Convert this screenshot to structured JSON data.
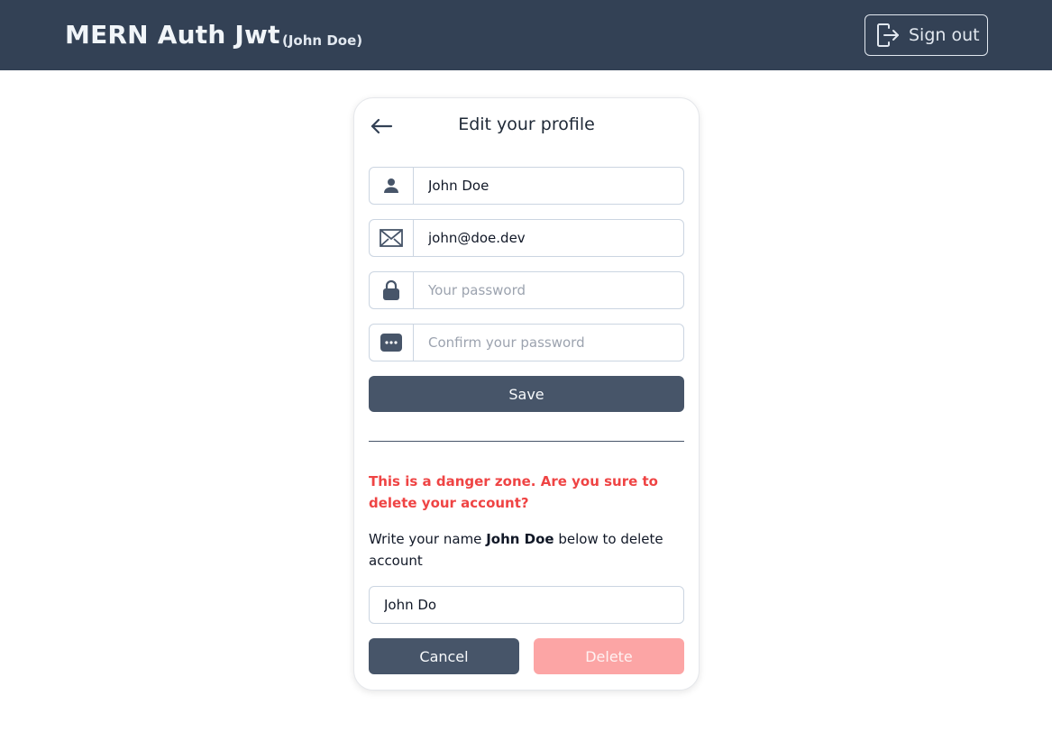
{
  "navbar": {
    "brand": "MERN Auth Jwt",
    "user_label": "(John Doe)",
    "signout_label": "Sign out",
    "signout_icon": "sign-out-icon"
  },
  "card": {
    "title": "Edit your profile",
    "back_icon": "arrow-left-icon",
    "fields": {
      "name": {
        "icon": "user-icon",
        "value": "John Doe",
        "placeholder": ""
      },
      "email": {
        "icon": "envelope-icon",
        "value": "john@doe.dev",
        "placeholder": ""
      },
      "password": {
        "icon": "lock-icon",
        "value": "",
        "placeholder": "Your password"
      },
      "confirm_password": {
        "icon": "dots-icon",
        "value": "",
        "placeholder": "Confirm your password"
      }
    },
    "save_label": "Save",
    "danger_text": "This is a danger zone. Are you sure to delete your account?",
    "instruction_prefix": "Write your name ",
    "instruction_name": "John Doe",
    "instruction_suffix": " below to delete account",
    "confirm_name_value": "John Do",
    "cancel_label": "Cancel",
    "delete_label": "Delete"
  },
  "colors": {
    "navbar_bg": "#334155",
    "button_primary": "#475569",
    "danger_text": "#ef4444",
    "delete_disabled": "#fca5a5"
  }
}
